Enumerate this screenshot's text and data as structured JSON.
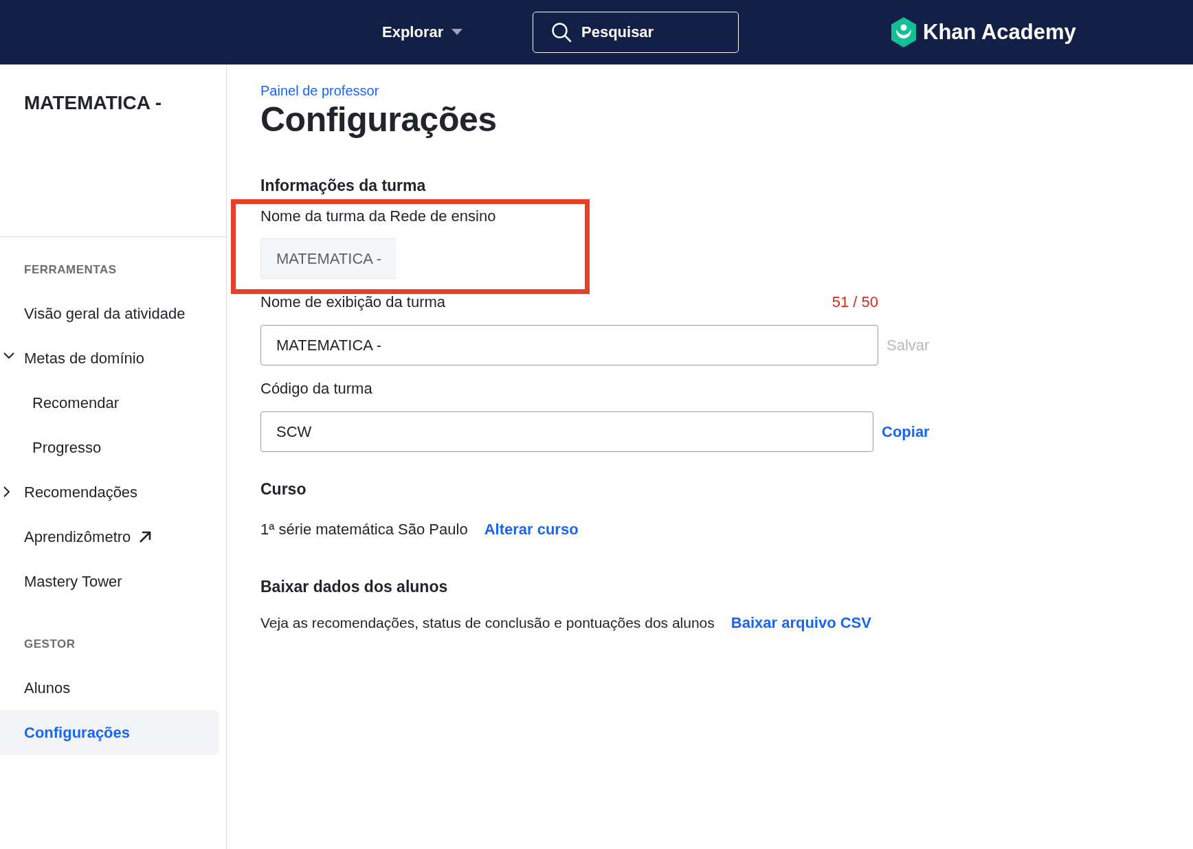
{
  "header": {
    "explore_label": "Explorar",
    "search": {
      "placeholder": "Pesquisar"
    },
    "logo_text": "Khan Academy"
  },
  "sidebar": {
    "class_title": "MATEMATICA -",
    "sections": [
      {
        "heading": "FERRAMENTAS",
        "items": [
          {
            "label": "Visão geral da atividade",
            "kind": "link",
            "selected": false
          },
          {
            "label": "Metas de domínio",
            "kind": "group",
            "expanded": true,
            "selected": false,
            "children": [
              {
                "label": "Recomendar",
                "selected": false
              },
              {
                "label": "Progresso",
                "selected": false
              }
            ]
          },
          {
            "label": "Recomendações",
            "kind": "group",
            "expanded": false,
            "selected": false
          },
          {
            "label": "Aprendizômetro",
            "kind": "external",
            "selected": false
          },
          {
            "label": "Mastery Tower",
            "kind": "link",
            "selected": false
          }
        ]
      },
      {
        "heading": "GESTOR",
        "items": [
          {
            "label": "Alunos",
            "kind": "link",
            "selected": false
          },
          {
            "label": "Configurações",
            "kind": "link",
            "selected": true
          }
        ]
      }
    ]
  },
  "main": {
    "breadcrumb": "Painel de professor",
    "title": "Configurações",
    "class_info": {
      "heading": "Informações da turma",
      "district_name": {
        "label": "Nome da turma da Rede de ensino",
        "value": "MATEMATICA -",
        "disabled": true,
        "highlighted": true
      },
      "display_name": {
        "label": "Nome de exibição da turma",
        "counter": "51 / 50",
        "over_limit": true,
        "value": "MATEMATICA -",
        "action": "Salvar",
        "action_disabled": true
      },
      "class_code": {
        "label": "Código da turma",
        "value": "SCW",
        "action": "Copiar",
        "action_disabled": false
      }
    },
    "course": {
      "heading": "Curso",
      "name": "1ª série matemática São Paulo",
      "link": "Alterar curso"
    },
    "download": {
      "heading": "Baixar dados dos alunos",
      "description": "Veja as recomendações, status de conclusão e pontuações dos alunos",
      "link": "Baixar arquivo CSV"
    }
  }
}
